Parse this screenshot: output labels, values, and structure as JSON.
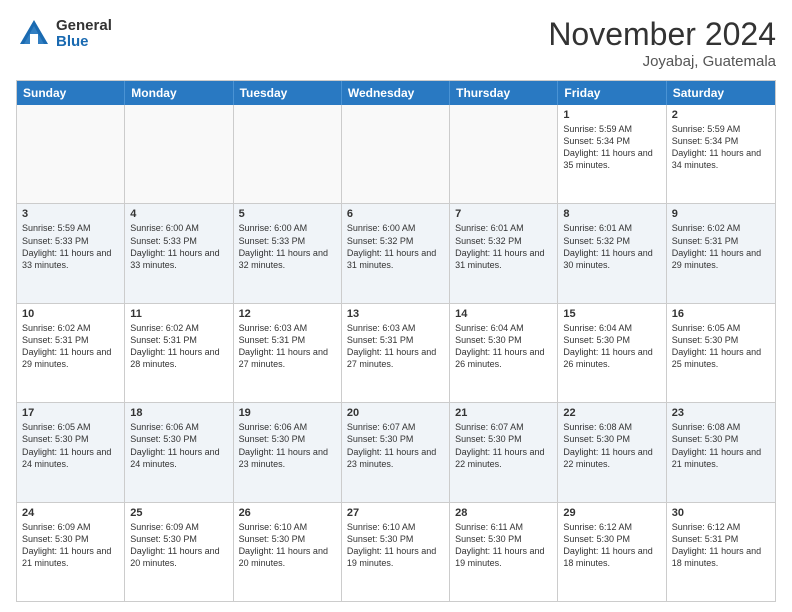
{
  "header": {
    "logo_general": "General",
    "logo_blue": "Blue",
    "month_title": "November 2024",
    "location": "Joyabaj, Guatemala"
  },
  "weekdays": [
    "Sunday",
    "Monday",
    "Tuesday",
    "Wednesday",
    "Thursday",
    "Friday",
    "Saturday"
  ],
  "weeks": [
    [
      {
        "day": "",
        "info": ""
      },
      {
        "day": "",
        "info": ""
      },
      {
        "day": "",
        "info": ""
      },
      {
        "day": "",
        "info": ""
      },
      {
        "day": "",
        "info": ""
      },
      {
        "day": "1",
        "info": "Sunrise: 5:59 AM\nSunset: 5:34 PM\nDaylight: 11 hours\nand 35 minutes."
      },
      {
        "day": "2",
        "info": "Sunrise: 5:59 AM\nSunset: 5:34 PM\nDaylight: 11 hours\nand 34 minutes."
      }
    ],
    [
      {
        "day": "3",
        "info": "Sunrise: 5:59 AM\nSunset: 5:33 PM\nDaylight: 11 hours\nand 33 minutes."
      },
      {
        "day": "4",
        "info": "Sunrise: 6:00 AM\nSunset: 5:33 PM\nDaylight: 11 hours\nand 33 minutes."
      },
      {
        "day": "5",
        "info": "Sunrise: 6:00 AM\nSunset: 5:33 PM\nDaylight: 11 hours\nand 32 minutes."
      },
      {
        "day": "6",
        "info": "Sunrise: 6:00 AM\nSunset: 5:32 PM\nDaylight: 11 hours\nand 31 minutes."
      },
      {
        "day": "7",
        "info": "Sunrise: 6:01 AM\nSunset: 5:32 PM\nDaylight: 11 hours\nand 31 minutes."
      },
      {
        "day": "8",
        "info": "Sunrise: 6:01 AM\nSunset: 5:32 PM\nDaylight: 11 hours\nand 30 minutes."
      },
      {
        "day": "9",
        "info": "Sunrise: 6:02 AM\nSunset: 5:31 PM\nDaylight: 11 hours\nand 29 minutes."
      }
    ],
    [
      {
        "day": "10",
        "info": "Sunrise: 6:02 AM\nSunset: 5:31 PM\nDaylight: 11 hours\nand 29 minutes."
      },
      {
        "day": "11",
        "info": "Sunrise: 6:02 AM\nSunset: 5:31 PM\nDaylight: 11 hours\nand 28 minutes."
      },
      {
        "day": "12",
        "info": "Sunrise: 6:03 AM\nSunset: 5:31 PM\nDaylight: 11 hours\nand 27 minutes."
      },
      {
        "day": "13",
        "info": "Sunrise: 6:03 AM\nSunset: 5:31 PM\nDaylight: 11 hours\nand 27 minutes."
      },
      {
        "day": "14",
        "info": "Sunrise: 6:04 AM\nSunset: 5:30 PM\nDaylight: 11 hours\nand 26 minutes."
      },
      {
        "day": "15",
        "info": "Sunrise: 6:04 AM\nSunset: 5:30 PM\nDaylight: 11 hours\nand 26 minutes."
      },
      {
        "day": "16",
        "info": "Sunrise: 6:05 AM\nSunset: 5:30 PM\nDaylight: 11 hours\nand 25 minutes."
      }
    ],
    [
      {
        "day": "17",
        "info": "Sunrise: 6:05 AM\nSunset: 5:30 PM\nDaylight: 11 hours\nand 24 minutes."
      },
      {
        "day": "18",
        "info": "Sunrise: 6:06 AM\nSunset: 5:30 PM\nDaylight: 11 hours\nand 24 minutes."
      },
      {
        "day": "19",
        "info": "Sunrise: 6:06 AM\nSunset: 5:30 PM\nDaylight: 11 hours\nand 23 minutes."
      },
      {
        "day": "20",
        "info": "Sunrise: 6:07 AM\nSunset: 5:30 PM\nDaylight: 11 hours\nand 23 minutes."
      },
      {
        "day": "21",
        "info": "Sunrise: 6:07 AM\nSunset: 5:30 PM\nDaylight: 11 hours\nand 22 minutes."
      },
      {
        "day": "22",
        "info": "Sunrise: 6:08 AM\nSunset: 5:30 PM\nDaylight: 11 hours\nand 22 minutes."
      },
      {
        "day": "23",
        "info": "Sunrise: 6:08 AM\nSunset: 5:30 PM\nDaylight: 11 hours\nand 21 minutes."
      }
    ],
    [
      {
        "day": "24",
        "info": "Sunrise: 6:09 AM\nSunset: 5:30 PM\nDaylight: 11 hours\nand 21 minutes."
      },
      {
        "day": "25",
        "info": "Sunrise: 6:09 AM\nSunset: 5:30 PM\nDaylight: 11 hours\nand 20 minutes."
      },
      {
        "day": "26",
        "info": "Sunrise: 6:10 AM\nSunset: 5:30 PM\nDaylight: 11 hours\nand 20 minutes."
      },
      {
        "day": "27",
        "info": "Sunrise: 6:10 AM\nSunset: 5:30 PM\nDaylight: 11 hours\nand 19 minutes."
      },
      {
        "day": "28",
        "info": "Sunrise: 6:11 AM\nSunset: 5:30 PM\nDaylight: 11 hours\nand 19 minutes."
      },
      {
        "day": "29",
        "info": "Sunrise: 6:12 AM\nSunset: 5:30 PM\nDaylight: 11 hours\nand 18 minutes."
      },
      {
        "day": "30",
        "info": "Sunrise: 6:12 AM\nSunset: 5:31 PM\nDaylight: 11 hours\nand 18 minutes."
      }
    ]
  ]
}
